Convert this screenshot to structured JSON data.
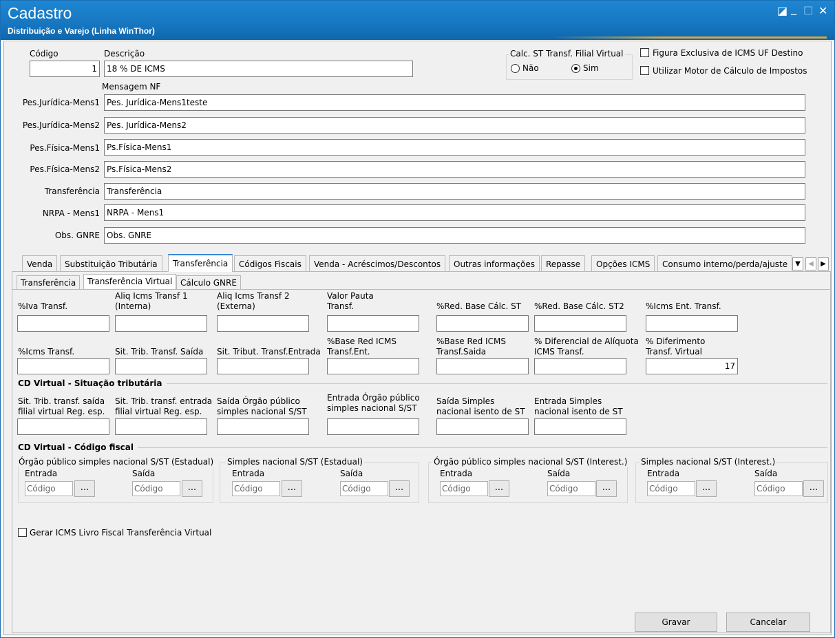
{
  "window": {
    "title": "Cadastro",
    "subtitle": "Distribuição e Varejo (Linha WinThor)",
    "restore_glyph": "◪",
    "minimize_glyph": "_",
    "maximize_glyph": "☐",
    "close_glyph": "✕"
  },
  "header": {
    "codigo_label": "Código",
    "codigo_value": "1",
    "descricao_label": "Descrição",
    "descricao_value": "18 % DE ICMS",
    "calc_st_label": "Calc. ST Transf. Filial Virtual",
    "radio_nao": "Não",
    "radio_sim": "Sim",
    "radio_selected": "Sim",
    "chk_figura": "Figura Exclusiva de ICMS UF Destino",
    "chk_motor": "Utilizar Motor de Cálculo de Impostos",
    "mensagem_nf_label": "Mensagem NF"
  },
  "messages": [
    {
      "label": "Pes.Jurídica-Mens1",
      "value": "Pes. Jurídica-Mens1teste"
    },
    {
      "label": "Pes.Jurídica-Mens2",
      "value": "Pes. Jurídica-Mens2"
    },
    {
      "label": "Pes.Física-Mens1",
      "value": "Ps.Física-Mens1"
    },
    {
      "label": "Pes.Física-Mens2",
      "value": "Ps.Física-Mens2"
    },
    {
      "label": "Transferência",
      "value": "Transferência"
    },
    {
      "label": "NRPA - Mens1",
      "value": "NRPA - Mens1"
    },
    {
      "label": "Obs. GNRE",
      "value": "Obs. GNRE"
    }
  ],
  "tabs": [
    "Venda",
    "Substituição Tributária",
    "Transferência",
    "Códigos Fiscais",
    "Venda - Acréscimos/Descontos",
    "Outras informações",
    "Repasse",
    "Opções ICMS",
    "Consumo interno/perda/ajuste"
  ],
  "active_tab": "Transferência",
  "subtabs": [
    "Transferência",
    "Transferência Virtual",
    "Cálculo GNRE"
  ],
  "active_subtab": "Transferência Virtual",
  "row1": [
    {
      "label": "%Iva Transf.",
      "value": ""
    },
    {
      "label": "Aliq Icms Transf 1\n(Interna)",
      "value": ""
    },
    {
      "label": "Aliq Icms Transf 2\n(Externa)",
      "value": ""
    },
    {
      "label": "Valor Pauta\nTransf.",
      "value": ""
    },
    {
      "label": "%Red. Base Cálc. ST",
      "value": ""
    },
    {
      "label": "%Red. Base Cálc. ST2",
      "value": ""
    },
    {
      "label": "%Icms Ent. Transf.",
      "value": ""
    }
  ],
  "row2": [
    {
      "label": "%Icms Transf.",
      "value": ""
    },
    {
      "label": "Sit. Trib. Transf. Saída",
      "value": ""
    },
    {
      "label": "Sit. Tribut. Transf.Entrada",
      "value": ""
    },
    {
      "label": "%Base Red ICMS\nTransf.Ent.",
      "value": ""
    },
    {
      "label": "%Base Red ICMS\nTransf.Saida",
      "value": ""
    },
    {
      "label": "% Diferencial de Alíquota\nICMS Transf.",
      "value": ""
    },
    {
      "label": "% Diferimento\nTransf. Virtual",
      "value": "17"
    }
  ],
  "section_sit_trib": {
    "title": "CD Virtual - Situação tributária",
    "fields": [
      {
        "label": "Sit. Trib. transf. saída\nfilial virtual Reg. esp.",
        "value": ""
      },
      {
        "label": "Sit. Trib. transf. entrada\nfilial virtual Reg. esp.",
        "value": ""
      },
      {
        "label": "Saída Órgão público\nsimples nacional S/ST",
        "value": ""
      },
      {
        "label": "Entrada Órgão público\nsimples nacional S/ST",
        "value": ""
      },
      {
        "label": "Saída Simples\nnacional isento de ST",
        "value": ""
      },
      {
        "label": "Entrada Simples\nnacional isento de ST",
        "value": ""
      }
    ]
  },
  "section_cod_fiscal": {
    "title": "CD Virtual - Código fiscal",
    "groups": [
      {
        "title": "Órgão público simples nacional S/ST (Estadual)"
      },
      {
        "title": "Simples nacional S/ST (Estadual)"
      },
      {
        "title": "Órgão público simples nacional S/ST (Interest.)"
      },
      {
        "title": "Simples nacional S/ST (Interest.)"
      }
    ],
    "entrada_label": "Entrada",
    "saida_label": "Saída",
    "codigo_placeholder": "Código",
    "dots_label": "..."
  },
  "chk_gerar": "Gerar ICMS Livro Fiscal Transferência Virtual",
  "buttons": {
    "gravar": "Gravar",
    "cancelar": "Cancelar"
  },
  "tab_scroll": {
    "dropdown": "▼",
    "left": "◀",
    "right": "▶"
  }
}
